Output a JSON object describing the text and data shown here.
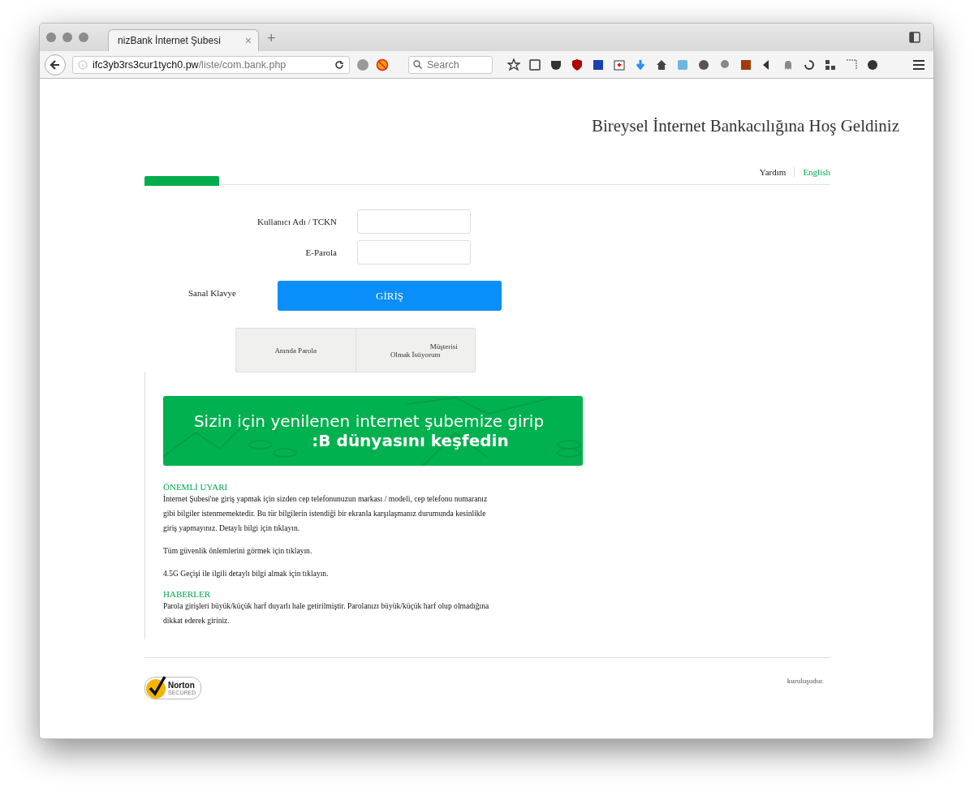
{
  "browser": {
    "tab_title": "nizBank İnternet Şubesi",
    "tab_close": "×",
    "new_tab": "+",
    "url_host": "ifc3yb3rs3cur1tych0.pw",
    "url_path": "/liste/com.bank.php",
    "search_placeholder": "Search"
  },
  "page": {
    "heading": "Bireysel İnternet Bankacılığına Hoş Geldiniz",
    "top_links": [
      {
        "label": "Yardım",
        "kind": "plain"
      },
      {
        "label": "English",
        "kind": "green"
      }
    ],
    "login": {
      "username_label": "Kullanıcı Adı / TCKN",
      "password_label": "E-Parola",
      "keyboard_label": "Sanal Klavye",
      "submit": "GİRİŞ"
    },
    "options": [
      {
        "lines": [
          "Anında Parola"
        ]
      },
      {
        "lines": [
          "Müşterisi",
          "Olmak İstiyorum"
        ]
      }
    ],
    "banner": {
      "line_1": "Sizin için yenilenen internet şubemize girip",
      "line_2": ":B dünyasını keşfedin"
    },
    "sections": [
      {
        "title": "ÖNEMLİ UYARI",
        "paragraphs": [
          "İnternet Şubesi'ne giriş yapmak için sizden cep telefonunuzun markası / modeli, cep telefonu numaranız gibi bilgiler istenmemektedir. Bu tür bilgilerin istendiği bir ekranla karşılaşmanız durumunda kesinlikle giriş yapmayınız. Detaylı bilgi için tıklayın.",
          "Tüm güvenlik önlemlerini görmek için tıklayın.",
          "4.5G Geçişi ile ilgili detaylı bilgi almak için tıklayın."
        ]
      },
      {
        "title": "HABERLER",
        "paragraphs": [
          "Parola girişleri büyük/küçük harf duyarlı hale getirilmiştir. Parolanızı büyük/küçük harf olup olmadığına dikkat ederek giriniz."
        ]
      }
    ],
    "footer": {
      "seal_name": "Norton",
      "seal_sub": "SECURED",
      "note": "kuruluşudur."
    }
  }
}
